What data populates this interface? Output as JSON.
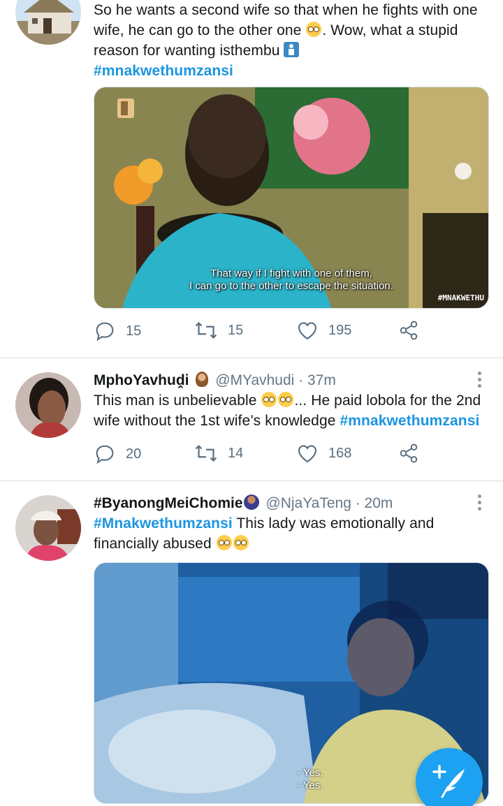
{
  "tweets": [
    {
      "text_pre": "So he wants a second wife so that when he fights with one wife, he can go to the other one ",
      "text_post": ". Wow, what a stupid reason for wanting isthembu ",
      "hashtag": "#mnakwethumzansi",
      "media_subtitle_1": "That way if I fight with one of them,",
      "media_subtitle_2": "I can go to the other to escape the situation.",
      "media_watermark": "#MNAKWETHU",
      "reply_count": "15",
      "retweet_count": "15",
      "like_count": "195"
    },
    {
      "name": "MphoYavhuḓi",
      "handle_time": "@MYavhudi · 37m",
      "text_pre": "This man is unbelievable ",
      "text_post": "... He paid lobola for the 2nd wife without the 1st wife’s knowledge ",
      "hashtag": "#mnakwethumzansi",
      "reply_count": "20",
      "retweet_count": "14",
      "like_count": "168"
    },
    {
      "name": "#ByanongMeiChomie",
      "handle_time": "@NjaYaTeng · 20m",
      "hashtag": "#Mnakwethumzansi",
      "text_post": " This lady was emotionally and financially abused ",
      "media_subtitle_1": "- Yes.",
      "media_subtitle_2": "- Yes."
    }
  ],
  "icons": {
    "reply": "reply-icon",
    "retweet": "retweet-icon",
    "like": "heart-icon",
    "share": "share-icon",
    "compose": "compose-tweet-icon"
  },
  "colors": {
    "accent": "#1da1f2",
    "hashtag": "#1b95e0",
    "muted": "#657786"
  }
}
